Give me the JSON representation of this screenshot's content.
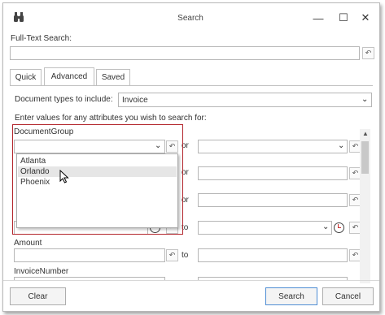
{
  "window": {
    "title": "Search",
    "minimize_glyph": "—",
    "maximize_glyph": "☐",
    "close_glyph": "✕"
  },
  "fulltext": {
    "label": "Full-Text Search:",
    "value": ""
  },
  "tabs": [
    {
      "label": "Quick",
      "active": false
    },
    {
      "label": "Advanced",
      "active": true
    },
    {
      "label": "Saved",
      "active": false
    }
  ],
  "doc_types": {
    "label": "Document types to include:",
    "value": "Invoice"
  },
  "instructions": "Enter values for any attributes you wish to search for:",
  "attributes": {
    "document_group": {
      "label": "DocumentGroup",
      "value": "",
      "or_label": "or",
      "options": [
        "Atlanta",
        "Orlando",
        "Phoenix"
      ],
      "highlighted": "Orlando"
    },
    "row2": {
      "or_label": "or"
    },
    "row3": {
      "or_label": "or"
    },
    "row4": {
      "to_label": "to"
    },
    "amount": {
      "label": "Amount",
      "to_label": "to",
      "value": ""
    },
    "invoice_number": {
      "label": "InvoiceNumber"
    }
  },
  "buttons": {
    "clear": "Clear",
    "search": "Search",
    "cancel": "Cancel"
  },
  "icons": {
    "app": "binoculars-icon",
    "undo": "undo-icon",
    "dropdown": "chevron-down-icon",
    "time": "clock-icon",
    "cursor": "mouse-pointer-icon"
  }
}
